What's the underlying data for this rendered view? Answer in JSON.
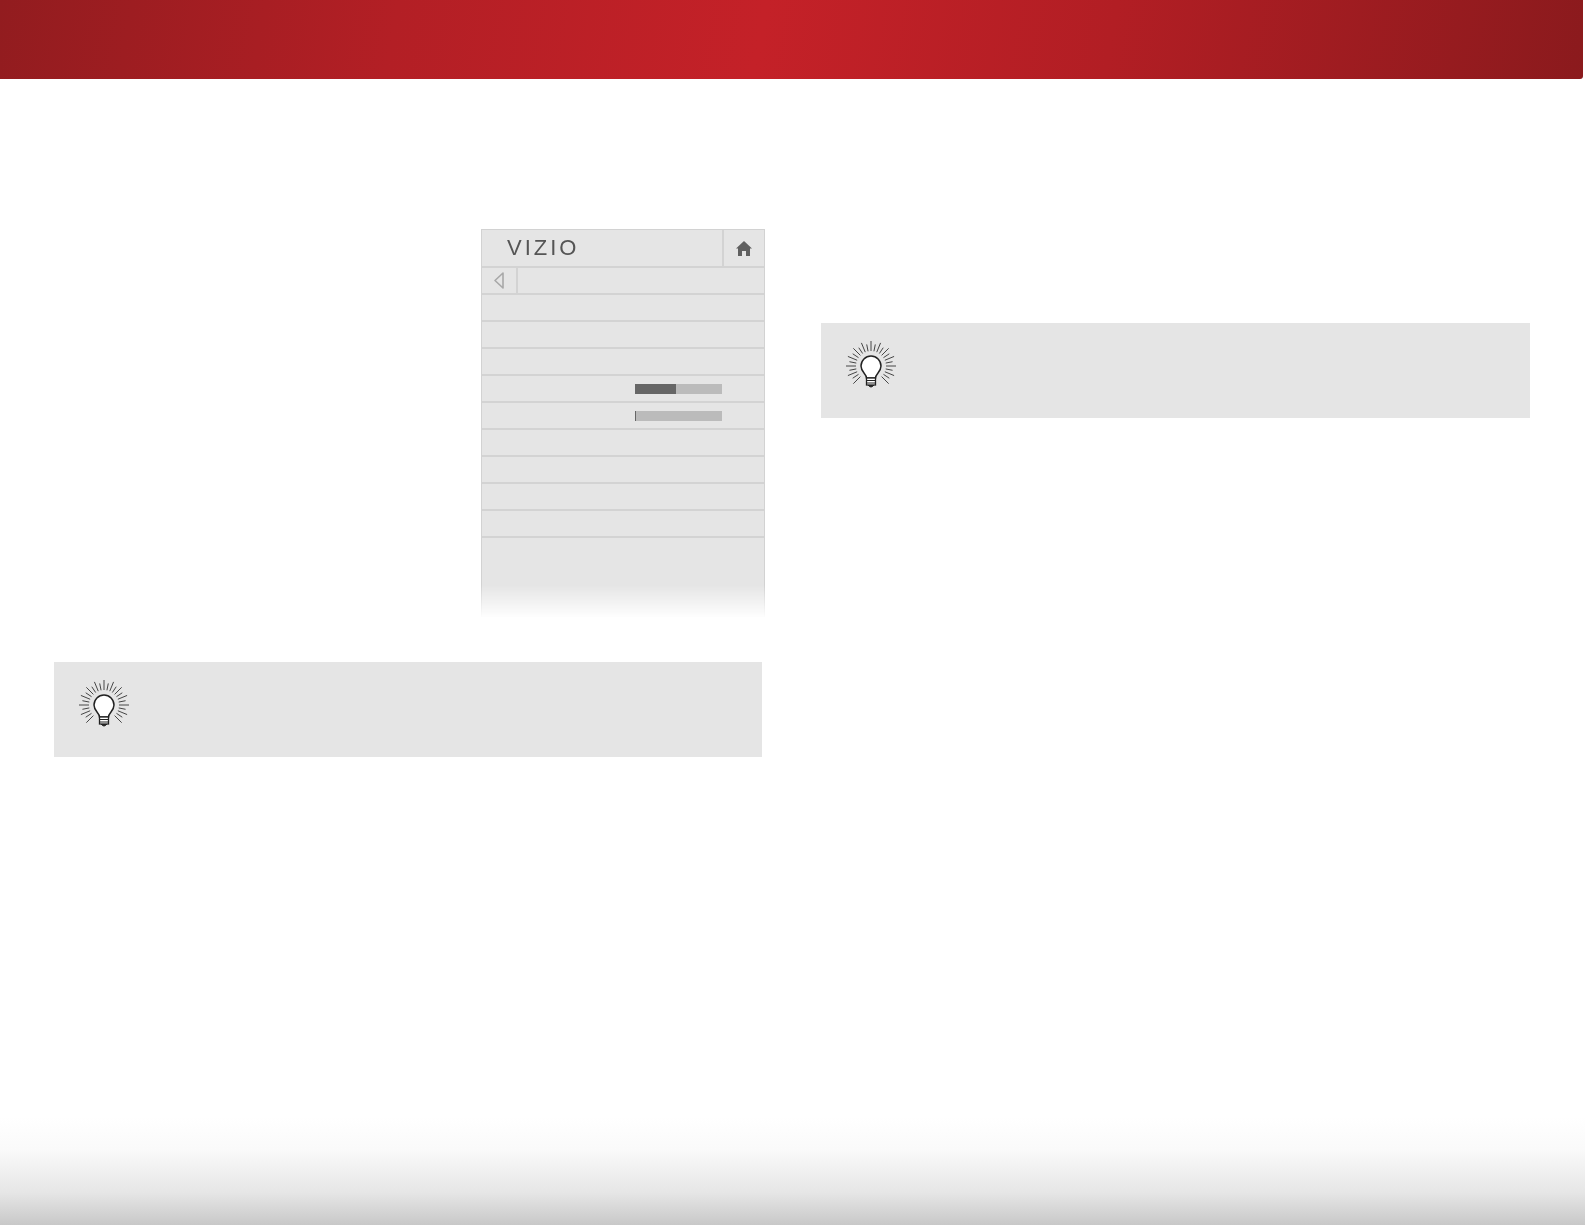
{
  "left_column": [
    {
      "kind": "menu_screenshot",
      "logo": "VIZIO",
      "rows": [
        {
          "kind": "plain"
        },
        {
          "kind": "plain"
        },
        {
          "kind": "plain"
        },
        {
          "kind": "slider",
          "level": 0.47
        },
        {
          "kind": "slider",
          "level": 0
        },
        {
          "kind": "plain"
        },
        {
          "kind": "plain"
        },
        {
          "kind": "plain"
        },
        {
          "kind": "plain"
        }
      ]
    },
    {
      "kind": "tip"
    }
  ],
  "right_column": [
    {
      "kind": "tip"
    }
  ]
}
